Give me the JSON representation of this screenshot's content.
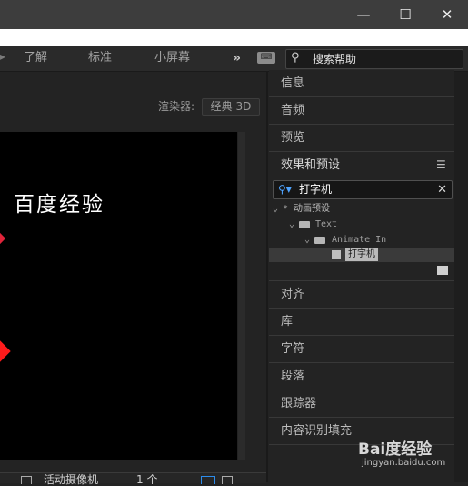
{
  "window": {
    "minimize_glyph": "—",
    "maximize_glyph": "☐",
    "close_glyph": "✕"
  },
  "workspace": {
    "tabs": [
      "了解",
      "标准",
      "小屏幕"
    ],
    "more_glyph": "»",
    "search_placeholder": "搜索帮助"
  },
  "composition": {
    "renderer_label": "渲染器:",
    "renderer_value": "经典 3D",
    "viewer_title": "百度经验",
    "camera_label": "活动摄像机",
    "views_label": "1 个"
  },
  "right_panel": {
    "top_sections": [
      "信息",
      "音频",
      "预览"
    ],
    "effects": {
      "title": "效果和预设",
      "search_value": "打字机",
      "tree": {
        "root": "动画预设",
        "level1": "Text",
        "level2": "Animate In",
        "selected_preset": "打字机"
      }
    },
    "bottom_sections": [
      "对齐",
      "库",
      "字符",
      "段落",
      "跟踪器",
      "内容识别填充"
    ]
  },
  "watermark": {
    "brand": "Bai度经验",
    "url": "jingyan.baidu.com"
  },
  "colors": {
    "accent_blue": "#2d8ceb",
    "handle_red": "#ff1b1b"
  }
}
